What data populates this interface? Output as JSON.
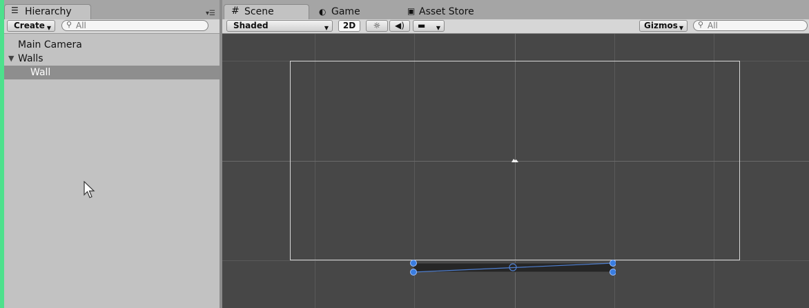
{
  "hierarchy": {
    "tab_label": "Hierarchy",
    "tab_icon": "list-icon",
    "create_label": "Create",
    "search_placeholder": "All",
    "items": [
      {
        "label": "Main Camera",
        "depth": 0,
        "expander": false,
        "selected": false
      },
      {
        "label": "Walls",
        "depth": 0,
        "expander": true,
        "selected": false
      },
      {
        "label": "Wall",
        "depth": 1,
        "expander": false,
        "selected": true
      }
    ]
  },
  "scene": {
    "tabs": [
      {
        "label": "Scene",
        "icon": "grid-icon",
        "active": true
      },
      {
        "label": "Game",
        "icon": "pacman-icon",
        "active": false
      },
      {
        "label": "Asset Store",
        "icon": "bag-icon",
        "active": false
      }
    ],
    "toolbar": {
      "shading_mode": "Shaded",
      "mode_2d_label": "2D",
      "gizmos_label": "Gizmos",
      "search_placeholder": "All"
    }
  },
  "colors": {
    "viewport_bg": "#474747",
    "selection_handle": "#3a7de0",
    "selection_bg": "#8e8e8e"
  }
}
